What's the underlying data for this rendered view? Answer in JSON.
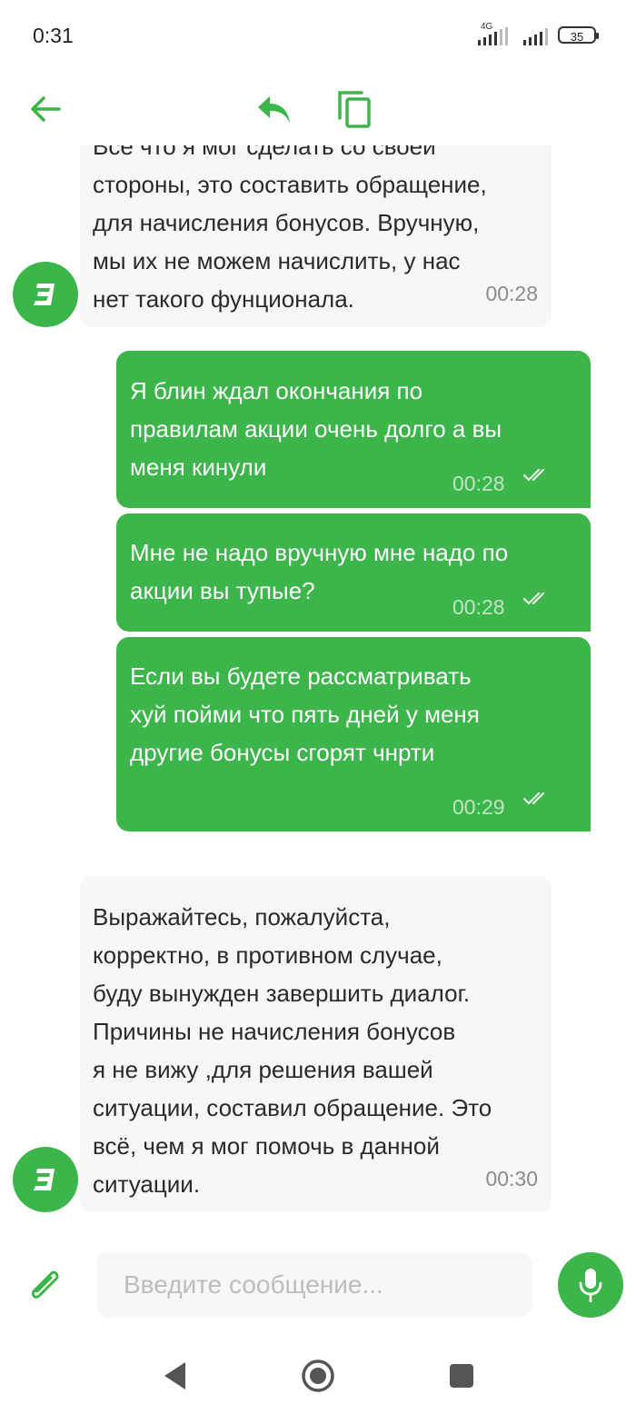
{
  "status_bar": {
    "time": "0:31",
    "network": "4G",
    "battery": "35"
  },
  "toolbar": {
    "back_icon": "arrow-left-icon",
    "reply_icon": "reply-icon",
    "copy_icon": "copy-icon",
    "accent": "#3cb54a"
  },
  "messages": [
    {
      "direction": "incoming",
      "text": "Все что я мог сделать со своей\nстороны, это составить обращение,\nдля начисления бонусов. Вручную,\nмы их не можем начислить, у нас\nнет такого фунционала.",
      "time": "00:28"
    },
    {
      "direction": "outgoing",
      "text": "Я блин ждал окончания по\nправилам акции очень долго а вы\nменя кинули",
      "time": "00:28",
      "read": true
    },
    {
      "direction": "outgoing",
      "text": "Мне не надо вручную мне надо по\nакции вы тупые?",
      "time": "00:28",
      "read": true
    },
    {
      "direction": "outgoing",
      "text": "Если вы будете рассматривать\nхуй пойми что пять дней у меня\nдругие бонусы сгорят чнрти",
      "time": "00:29",
      "read": true
    },
    {
      "direction": "incoming",
      "text": "Выражайтесь, пожалуйста,\nкорректно, в противном случае,\nбуду вынужден завершить диалог.\nПричины не начисления бонусов\nя не вижу ,для решения вашей\nситуации, составил обращение. Это\nвсё, чем я мог помочь в данной\nситуации.",
      "time": "00:30"
    }
  ],
  "composer": {
    "placeholder": "Введите сообщение...",
    "value": "",
    "attach_icon": "paperclip-icon",
    "mic_icon": "microphone-icon"
  },
  "nav": {
    "back_icon": "triangle-back-icon",
    "home_icon": "circle-home-icon",
    "recents_icon": "square-recents-icon"
  }
}
